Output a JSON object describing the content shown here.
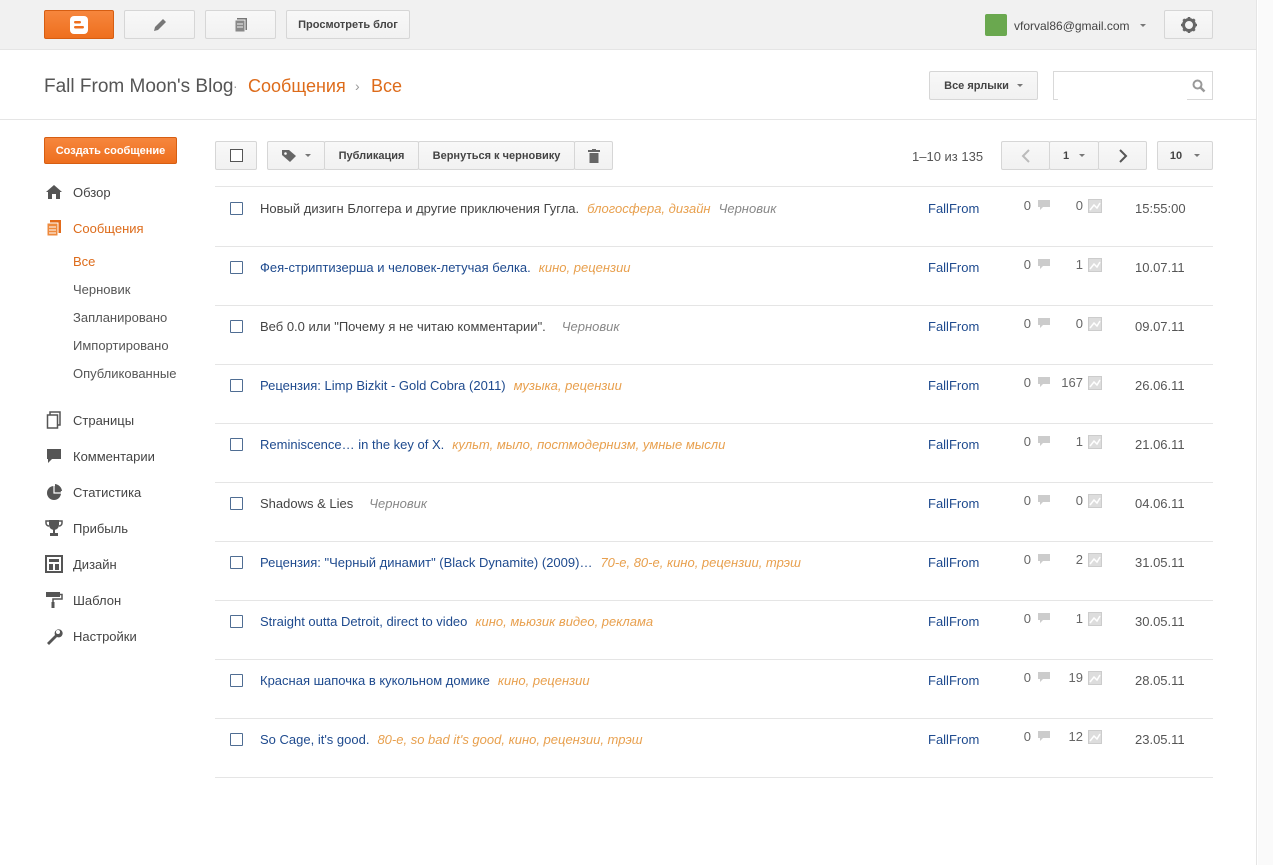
{
  "topbar": {
    "view_blog": "Просмотреть блог",
    "user_email": "vforval86@gmail.com"
  },
  "header": {
    "blog_title": "Fall From Moon's Blog",
    "crumb_posts": "Сообщения",
    "crumb_all": "Все",
    "labels_dropdown": "Все ярлыки",
    "search_placeholder": ""
  },
  "sidebar": {
    "create_post": "Создать сообщение",
    "items": [
      {
        "label": "Обзор",
        "icon": "home-icon"
      },
      {
        "label": "Сообщения",
        "icon": "posts-icon"
      },
      {
        "label": "Страницы",
        "icon": "pages-icon"
      },
      {
        "label": "Комментарии",
        "icon": "comment-icon"
      },
      {
        "label": "Статистика",
        "icon": "pie-chart-icon"
      },
      {
        "label": "Прибыль",
        "icon": "trophy-icon"
      },
      {
        "label": "Дизайн",
        "icon": "layout-icon"
      },
      {
        "label": "Шаблон",
        "icon": "paint-roller-icon"
      },
      {
        "label": "Настройки",
        "icon": "wrench-icon"
      }
    ],
    "sub_items": [
      "Все",
      "Черновик",
      "Запланировано",
      "Импортировано",
      "Опубликованные"
    ]
  },
  "toolbar": {
    "publish": "Публикация",
    "revert": "Вернуться к черновику",
    "range": "1–10 из 135",
    "page": "1",
    "per_page": "10"
  },
  "posts": [
    {
      "title": "Новый дизигн Блоггера и другие приключения Гугла.",
      "labels": "блогосфера, дизайн",
      "status": "Черновик",
      "author": "FallFrom",
      "comments": "0",
      "views": "0",
      "date": "15:55:00",
      "draft": true
    },
    {
      "title": "Фея-стриптизерша и человек-летучая белка.",
      "labels": "кино, рецензии",
      "status": "",
      "author": "FallFrom",
      "comments": "0",
      "views": "1",
      "date": "10.07.11",
      "draft": false
    },
    {
      "title": "Веб 0.0 или \"Почему я не читаю комментарии\".",
      "labels": "",
      "status": "Черновик",
      "author": "FallFrom",
      "comments": "0",
      "views": "0",
      "date": "09.07.11",
      "draft": true
    },
    {
      "title": "Рецензия: Limp Bizkit - Gold Cobra (2011)",
      "labels": "музыка, рецензии",
      "status": "",
      "author": "FallFrom",
      "comments": "0",
      "views": "167",
      "date": "26.06.11",
      "draft": false
    },
    {
      "title": "Reminiscence… in the key of X.",
      "labels": "культ, мыло, постмодернизм, умные мысли",
      "status": "",
      "author": "FallFrom",
      "comments": "0",
      "views": "1",
      "date": "21.06.11",
      "draft": false
    },
    {
      "title": "Shadows & Lies",
      "labels": "",
      "status": "Черновик",
      "author": "FallFrom",
      "comments": "0",
      "views": "0",
      "date": "04.06.11",
      "draft": true
    },
    {
      "title": "Рецензия: \"Черный динамит\" (Black Dynamite) (2009)…",
      "labels": "70-е, 80-е, кино, рецензии, трэш",
      "status": "",
      "author": "FallFrom",
      "comments": "0",
      "views": "2",
      "date": "31.05.11",
      "draft": false
    },
    {
      "title": "Straight outta Detroit, direct to video",
      "labels": "кино, мьюзик видео, реклама",
      "status": "",
      "author": "FallFrom",
      "comments": "0",
      "views": "1",
      "date": "30.05.11",
      "draft": false
    },
    {
      "title": "Красная шапочка в кукольном домике",
      "labels": "кино, рецензии",
      "status": "",
      "author": "FallFrom",
      "comments": "0",
      "views": "19",
      "date": "28.05.11",
      "draft": false
    },
    {
      "title": "So Cage, it's good.",
      "labels": "80-е, so bad it's good, кино, рецензии, трэш",
      "status": "",
      "author": "FallFrom",
      "comments": "0",
      "views": "12",
      "date": "23.05.11",
      "draft": false
    }
  ],
  "colors": {
    "accent": "#ee6f1e",
    "link": "#1e4a8e",
    "label": "#e8a04e"
  }
}
